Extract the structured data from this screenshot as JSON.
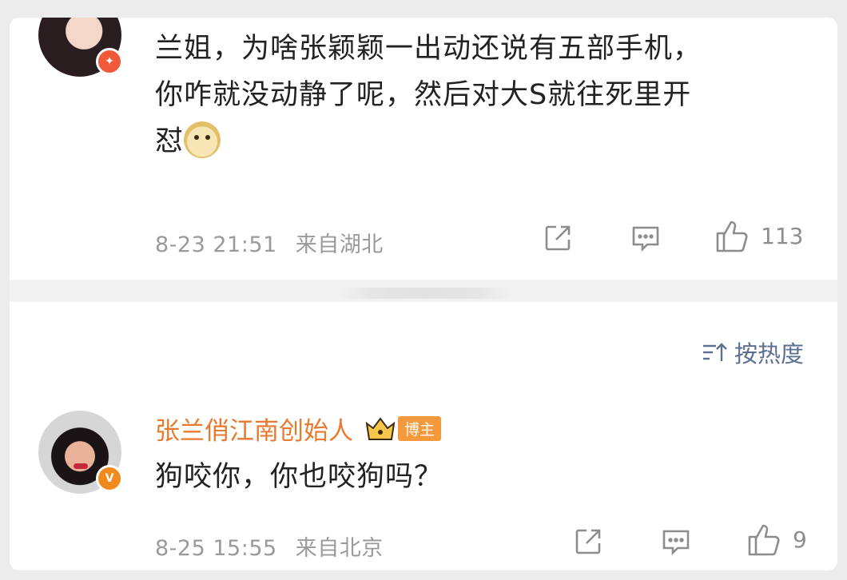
{
  "comments": [
    {
      "text_line1": "兰姐，为啥张颖颖一出动还说有五部手机，",
      "text_line2": "你咋就没动静了呢，然后对大S就往死里开",
      "text_line3": "怼",
      "emoji": "doge-emoji",
      "time": "8-23 21:51",
      "location": "来自湖北",
      "likes": "113",
      "badge_icon": "star-badge-icon"
    },
    {
      "username": "张兰俏江南创始人",
      "role_tag": "博主",
      "text": "狗咬你，你也咬狗吗？",
      "time": "8-25 15:55",
      "location": "来自北京",
      "likes": "9",
      "badge_icon": "verified-v-icon"
    }
  ],
  "sort": {
    "label": "按热度"
  },
  "colors": {
    "username": "#e8792d",
    "sort_link": "#5b6f8f",
    "meta": "#9a9a9a",
    "icon": "#8d8d8d"
  }
}
